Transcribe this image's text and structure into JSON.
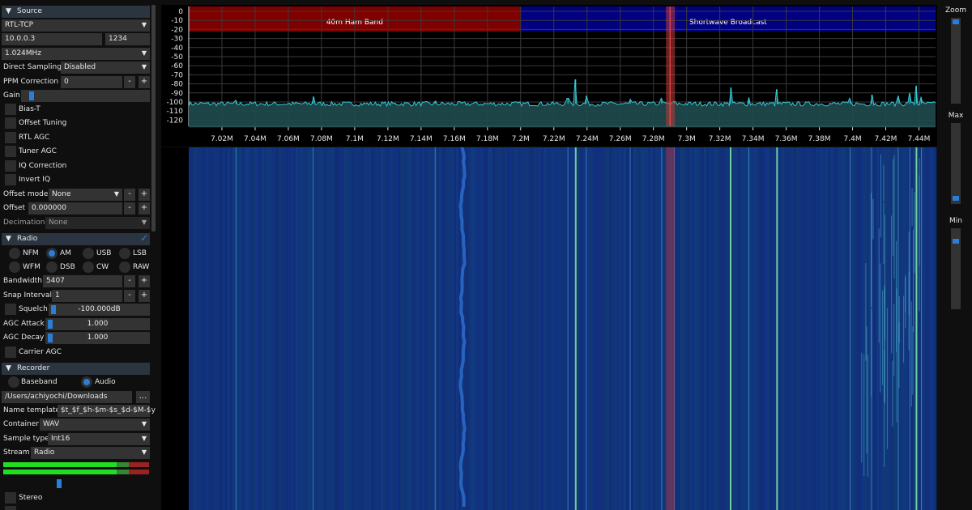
{
  "source": {
    "header": "Source",
    "source_type": "RTL-TCP",
    "host": "10.0.0.3",
    "port": "1234",
    "sample_rate": "1.024MHz",
    "direct_sampling_label": "Direct Sampling",
    "direct_sampling_value": "Disabled",
    "ppm_label": "PPM Correction",
    "ppm_value": "0",
    "gain_label": "Gain",
    "gain_level": 0.05,
    "checkboxes": [
      "Bias-T",
      "Offset Tuning",
      "RTL AGC",
      "Tuner AGC",
      "IQ Correction",
      "Invert IQ"
    ],
    "offset_mode_label": "Offset mode",
    "offset_mode_value": "None",
    "offset_label": "Offset",
    "offset_value": "0.000000",
    "decimation_label": "Decimation",
    "decimation_value": "None"
  },
  "radio": {
    "header": "Radio",
    "modes": [
      "NFM",
      "AM",
      "USB",
      "LSB",
      "WFM",
      "DSB",
      "CW",
      "RAW"
    ],
    "selected_mode": "AM",
    "bandwidth_label": "Bandwidth",
    "bandwidth_value": "5407",
    "snap_label": "Snap Interval",
    "snap_value": "1",
    "squelch_label": "Squelch",
    "squelch_value": "-100.000dB",
    "agc_attack_label": "AGC Attack",
    "agc_attack_value": "1.000",
    "agc_decay_label": "AGC Decay",
    "agc_decay_value": "1.000",
    "carrier_agc_label": "Carrier AGC"
  },
  "recorder": {
    "header": "Recorder",
    "modes": [
      "Baseband",
      "Audio"
    ],
    "selected_mode": "Audio",
    "folder": "/Users/achiyochi/Downloads",
    "browse_label": "...",
    "name_template_label": "Name template",
    "name_template_value": "$t_$f_$h-$m-$s_$d-$M-$y",
    "container_label": "Container",
    "container_value": "WAV",
    "sample_type_label": "Sample type",
    "sample_type_value": "Int16",
    "stream_label": "Stream",
    "stream_value": "Radio",
    "stereo_label": "Stereo"
  },
  "spectrum": {
    "y_ticks": [
      "0",
      "-10",
      "-20",
      "-30",
      "-40",
      "-50",
      "-60",
      "-70",
      "-80",
      "-90",
      "-100",
      "-110",
      "-120"
    ],
    "x_ticks": [
      "7.02M",
      "7.04M",
      "7.06M",
      "7.08M",
      "7.1M",
      "7.12M",
      "7.14M",
      "7.16M",
      "7.18M",
      "7.2M",
      "7.22M",
      "7.24M",
      "7.26M",
      "7.28M",
      "7.3M",
      "7.32M",
      "7.34M",
      "7.36M",
      "7.38M",
      "7.4M",
      "7.42M",
      "7.44M"
    ],
    "bands": [
      {
        "name": "40m Ham Band",
        "start_mhz": 7.0,
        "end_mhz": 7.2,
        "color": "#800000"
      },
      {
        "name": "Shortwave Broadcast",
        "start_mhz": 7.2,
        "end_mhz": 7.45,
        "color": "#000080"
      }
    ],
    "vfo_mhz": 7.29,
    "noise_floor_db": -102,
    "peaks": [
      {
        "mhz": 7.0285,
        "db": -98
      },
      {
        "mhz": 7.075,
        "db": -94
      },
      {
        "mhz": 7.1485,
        "db": -99
      },
      {
        "mhz": 7.2285,
        "db": -96
      },
      {
        "mhz": 7.2332,
        "db": -75
      },
      {
        "mhz": 7.2395,
        "db": -93
      },
      {
        "mhz": 7.266,
        "db": -97
      },
      {
        "mhz": 7.285,
        "db": -96
      },
      {
        "mhz": 7.2925,
        "db": -99
      },
      {
        "mhz": 7.3265,
        "db": -84
      },
      {
        "mhz": 7.3375,
        "db": -95
      },
      {
        "mhz": 7.3545,
        "db": -86
      },
      {
        "mhz": 7.3985,
        "db": -96
      },
      {
        "mhz": 7.4115,
        "db": -92
      },
      {
        "mhz": 7.4275,
        "db": -93
      },
      {
        "mhz": 7.4345,
        "db": -90
      },
      {
        "mhz": 7.4385,
        "db": -82
      },
      {
        "mhz": 7.4415,
        "db": -95
      }
    ]
  },
  "side": {
    "zoom_label": "Zoom",
    "max_label": "Max",
    "min_label": "Min",
    "zoom_level": 0.0,
    "max_level": 0.0,
    "min_level": 0.9
  }
}
